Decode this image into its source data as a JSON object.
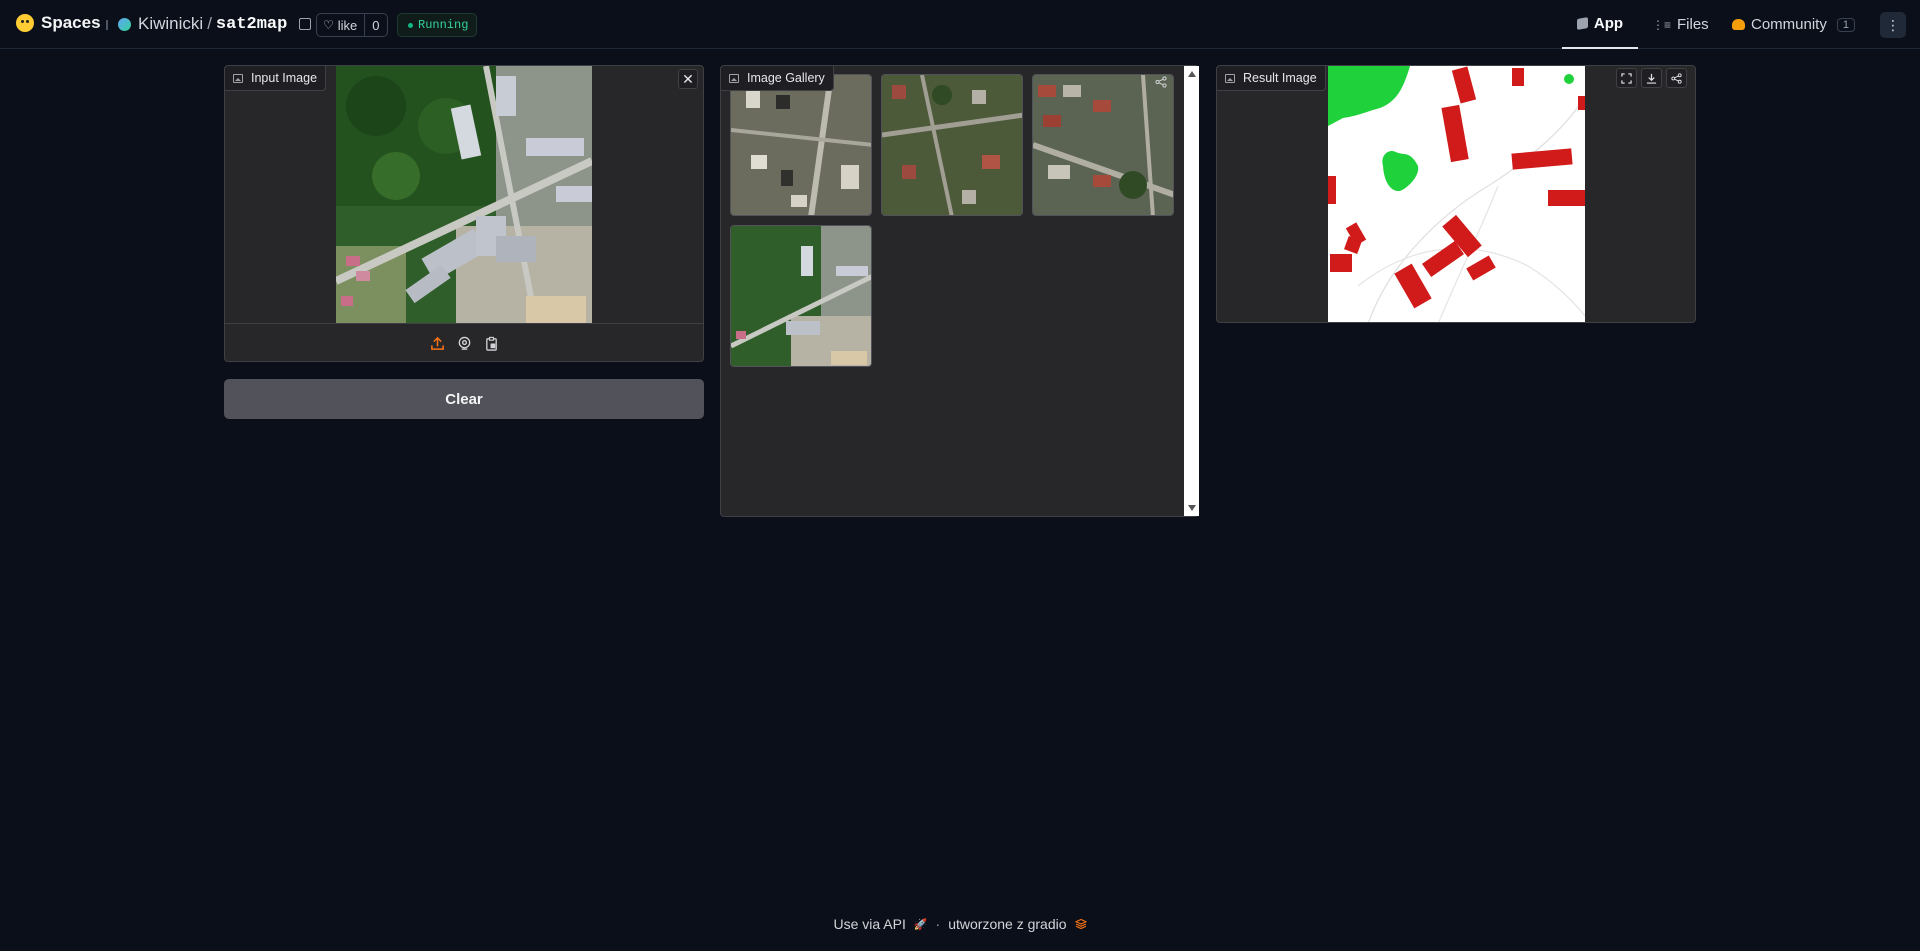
{
  "header": {
    "brand": "Spaces",
    "owner": "Kiwinicki",
    "slash": "/",
    "repo": "sat2map",
    "like_label": "like",
    "like_count": "0",
    "status": "Running",
    "nav": {
      "app": "App",
      "files": "Files",
      "community": "Community",
      "community_count": "1"
    }
  },
  "input": {
    "label": "Input Image"
  },
  "clear_label": "Clear",
  "gallery": {
    "label": "Image Gallery",
    "count": 4
  },
  "result": {
    "label": "Result Image"
  },
  "footer": {
    "api": "Use via API",
    "dot": "·",
    "built": "utworzone z gradio"
  },
  "colors": {
    "accent_orange": "#f97316",
    "running": "#34d399",
    "building_red": "#d11a1a",
    "vegetation_green": "#1fd13b"
  }
}
